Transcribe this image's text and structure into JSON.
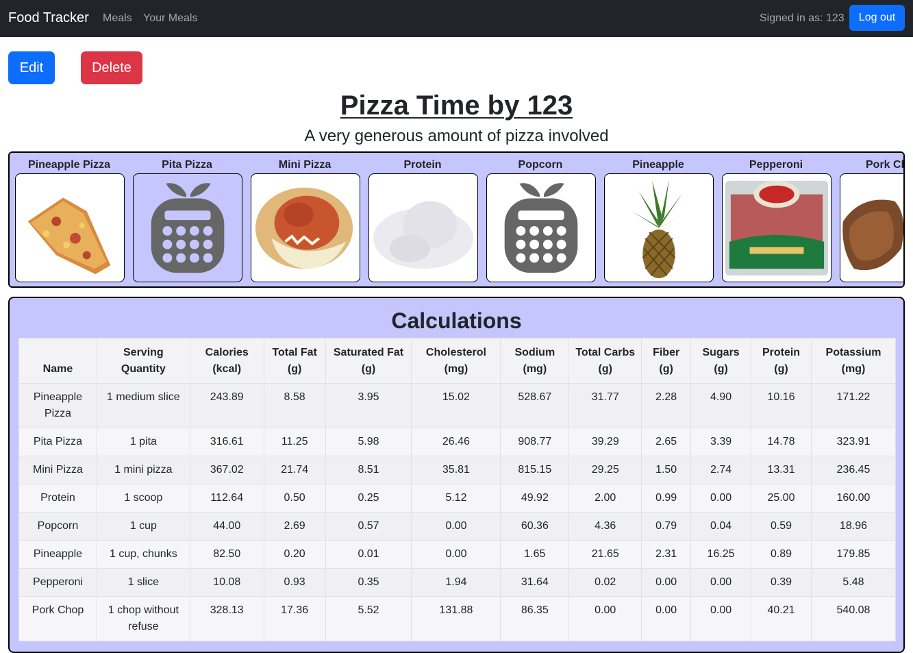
{
  "navbar": {
    "brand": "Food Tracker",
    "links": [
      "Meals",
      "Your Meals"
    ],
    "signed_in": "Signed in as: 123",
    "logout": "Log out"
  },
  "actions": {
    "edit": "Edit",
    "delete": "Delete"
  },
  "meal": {
    "title": "Pizza Time by 123",
    "description": "A very generous amount of pizza involved"
  },
  "foods": [
    {
      "name": "Pineapple Pizza",
      "image": "pizza-slice-photo"
    },
    {
      "name": "Pita Pizza",
      "image": "placeholder-calculator-icon"
    },
    {
      "name": "Mini Pizza",
      "image": "mini-pizza-photo"
    },
    {
      "name": "Protein",
      "image": "protein-powder-photo"
    },
    {
      "name": "Popcorn",
      "image": "placeholder-calculator-icon"
    },
    {
      "name": "Pineapple",
      "image": "pineapple-photo"
    },
    {
      "name": "Pepperoni",
      "image": "pepperoni-package-photo"
    },
    {
      "name": "Pork Ch",
      "image": "pork-chop-photo"
    }
  ],
  "calculations": {
    "title": "Calculations",
    "headers": [
      "Name",
      "Serving Quantity",
      "Calories (kcal)",
      "Total Fat (g)",
      "Saturated Fat (g)",
      "Cholesterol (mg)",
      "Sodium (mg)",
      "Total Carbs (g)",
      "Fiber (g)",
      "Sugars (g)",
      "Protein (g)",
      "Potassium (mg)"
    ],
    "rows": [
      [
        "Pineapple Pizza",
        "1 medium slice",
        "243.89",
        "8.58",
        "3.95",
        "15.02",
        "528.67",
        "31.77",
        "2.28",
        "4.90",
        "10.16",
        "171.22"
      ],
      [
        "Pita Pizza",
        "1 pita",
        "316.61",
        "11.25",
        "5.98",
        "26.46",
        "908.77",
        "39.29",
        "2.65",
        "3.39",
        "14.78",
        "323.91"
      ],
      [
        "Mini Pizza",
        "1 mini pizza",
        "367.02",
        "21.74",
        "8.51",
        "35.81",
        "815.15",
        "29.25",
        "1.50",
        "2.74",
        "13.31",
        "236.45"
      ],
      [
        "Protein",
        "1 scoop",
        "112.64",
        "0.50",
        "0.25",
        "5.12",
        "49.92",
        "2.00",
        "0.99",
        "0.00",
        "25.00",
        "160.00"
      ],
      [
        "Popcorn",
        "1 cup",
        "44.00",
        "2.69",
        "0.57",
        "0.00",
        "60.36",
        "4.36",
        "0.79",
        "0.04",
        "0.59",
        "18.96"
      ],
      [
        "Pineapple",
        "1 cup, chunks",
        "82.50",
        "0.20",
        "0.01",
        "0.00",
        "1.65",
        "21.65",
        "2.31",
        "16.25",
        "0.89",
        "179.85"
      ],
      [
        "Pepperoni",
        "1 slice",
        "10.08",
        "0.93",
        "0.35",
        "1.94",
        "31.64",
        "0.02",
        "0.00",
        "0.00",
        "0.39",
        "5.48"
      ],
      [
        "Pork Chop",
        "1 chop without refuse",
        "328.13",
        "17.36",
        "5.52",
        "131.88",
        "86.35",
        "0.00",
        "0.00",
        "0.00",
        "40.21",
        "540.08"
      ]
    ]
  }
}
